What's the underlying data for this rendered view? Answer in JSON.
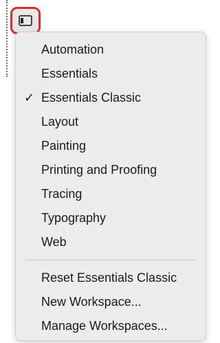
{
  "switcher": {
    "icon": "workspace-panel-icon",
    "highlight_color": "#e02a2a"
  },
  "menu": {
    "workspaces": [
      {
        "label": "Automation",
        "checked": false
      },
      {
        "label": "Essentials",
        "checked": false
      },
      {
        "label": "Essentials Classic",
        "checked": true
      },
      {
        "label": "Layout",
        "checked": false
      },
      {
        "label": "Painting",
        "checked": false
      },
      {
        "label": "Printing and Proofing",
        "checked": false
      },
      {
        "label": "Tracing",
        "checked": false
      },
      {
        "label": "Typography",
        "checked": false
      },
      {
        "label": "Web",
        "checked": false
      }
    ],
    "check_mark": "✓",
    "actions": [
      {
        "label": "Reset Essentials Classic"
      },
      {
        "label": "New Workspace..."
      },
      {
        "label": "Manage Workspaces..."
      }
    ]
  }
}
